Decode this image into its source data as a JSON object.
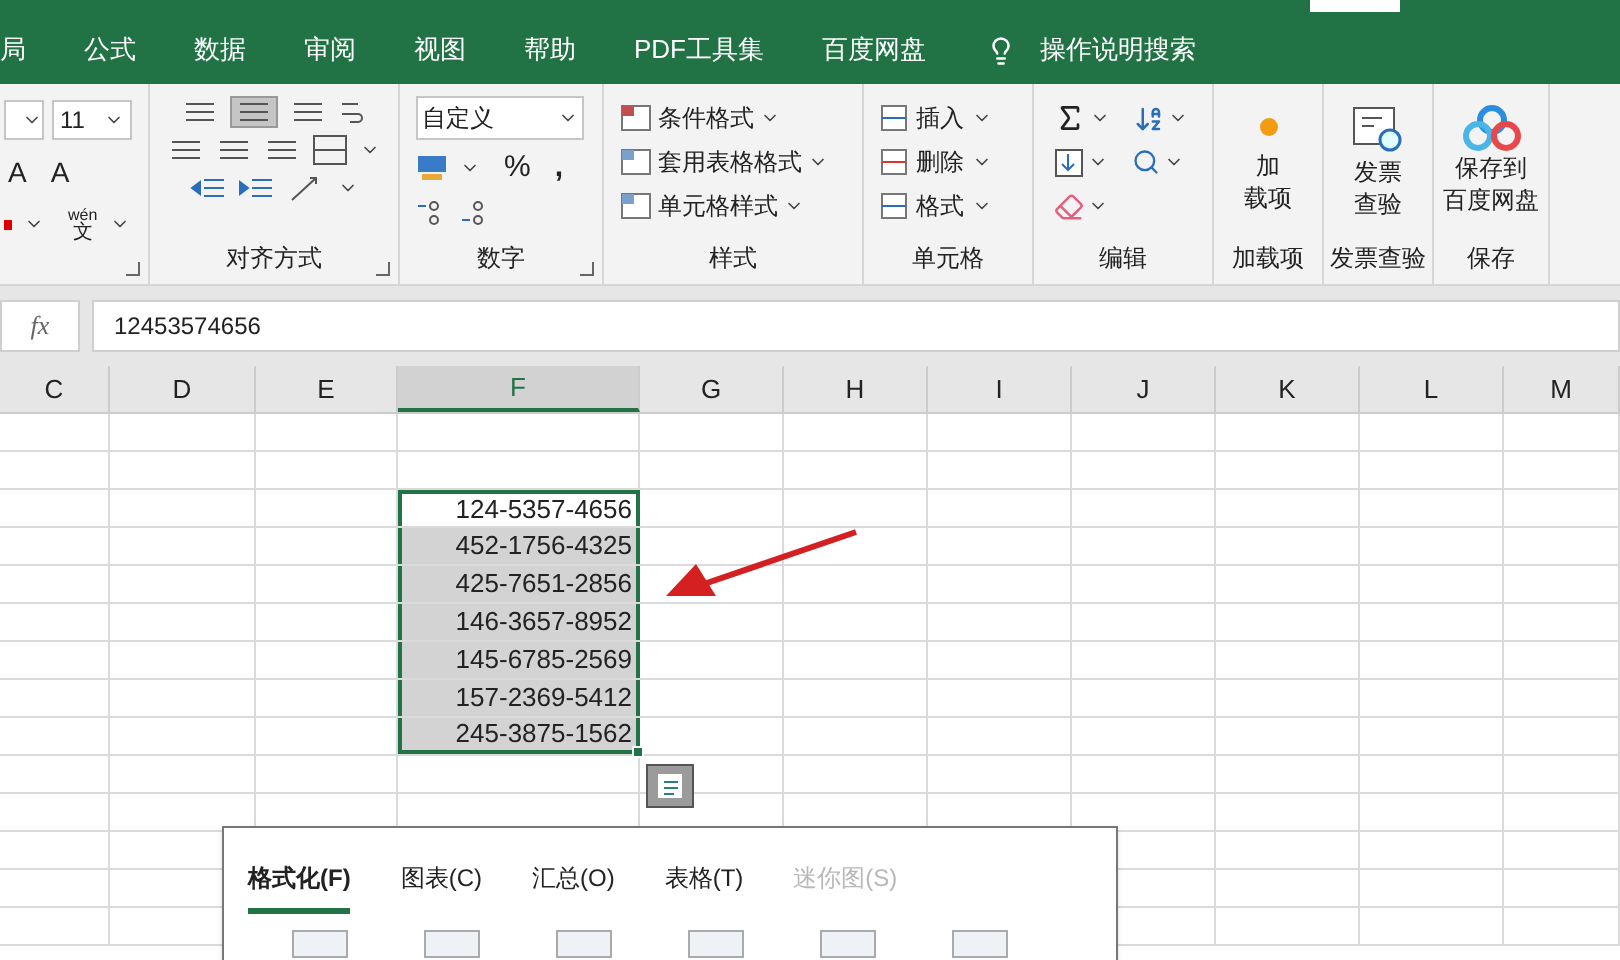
{
  "menu_tabs": [
    {
      "label": "局",
      "selected": false
    },
    {
      "label": "公式",
      "selected": false
    },
    {
      "label": "数据",
      "selected": false
    },
    {
      "label": "审阅",
      "selected": false
    },
    {
      "label": "视图",
      "selected": false
    },
    {
      "label": "帮助",
      "selected": false
    },
    {
      "label": "PDF工具集",
      "selected": false
    },
    {
      "label": "百度网盘",
      "selected": false
    }
  ],
  "tell_me": "操作说明搜索",
  "ribbon": {
    "font": {
      "size": "11",
      "grow_letters": [
        "A",
        "A"
      ],
      "phonetic": "wén",
      "phonetic_char": "文"
    },
    "alignment": {
      "label": "对齐方式"
    },
    "number": {
      "format": "自定义",
      "percent": "%",
      "comma": ",",
      "label": "数字"
    },
    "styles": {
      "items": [
        "条件格式",
        "套用表格格式",
        "单元格样式"
      ],
      "label": "样式"
    },
    "cells": {
      "items": [
        "插入",
        "删除",
        "格式"
      ],
      "label": "单元格"
    },
    "editing": {
      "label": "编辑"
    },
    "big_groups": [
      {
        "kind": "addin",
        "button": [
          "加",
          "载项"
        ],
        "label": "加载项"
      },
      {
        "kind": "invoice",
        "button": [
          "发票",
          "查验"
        ],
        "label": "发票查验"
      },
      {
        "kind": "cloud",
        "button": [
          "保存到",
          "百度网盘"
        ],
        "label": "保存"
      }
    ]
  },
  "formula_bar": {
    "fx": "fx",
    "value": "12453574656"
  },
  "columns": [
    {
      "label": "C",
      "selected": false
    },
    {
      "label": "D",
      "selected": false
    },
    {
      "label": "E",
      "selected": false
    },
    {
      "label": "F",
      "selected": true
    },
    {
      "label": "G",
      "selected": false
    },
    {
      "label": "H",
      "selected": false
    },
    {
      "label": "I",
      "selected": false
    },
    {
      "label": "J",
      "selected": false
    },
    {
      "label": "K",
      "selected": false
    },
    {
      "label": "L",
      "selected": false
    },
    {
      "label": "M",
      "selected": false
    }
  ],
  "cells": [
    {
      "value": "124-5357-4656",
      "active": true
    },
    {
      "value": "452-1756-4325",
      "active": false
    },
    {
      "value": "425-7651-2856",
      "active": false
    },
    {
      "value": "146-3657-8952",
      "active": false
    },
    {
      "value": "145-6785-2569",
      "active": false
    },
    {
      "value": "157-2369-5412",
      "active": false
    },
    {
      "value": "245-3875-1562",
      "active": false
    }
  ],
  "quick_analysis": {
    "tabs": [
      {
        "label": "格式化(F)",
        "selected": true,
        "disabled": false
      },
      {
        "label": "图表(C)",
        "selected": false,
        "disabled": false
      },
      {
        "label": "汇总(O)",
        "selected": false,
        "disabled": false
      },
      {
        "label": "表格(T)",
        "selected": false,
        "disabled": false
      },
      {
        "label": "迷你图(S)",
        "selected": false,
        "disabled": true
      }
    ]
  }
}
